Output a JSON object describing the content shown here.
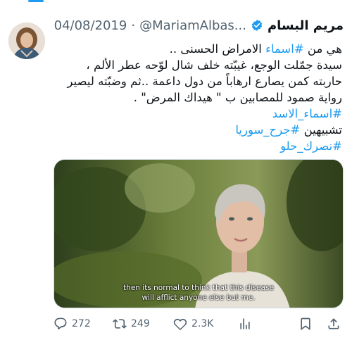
{
  "tweet": {
    "author_name": "مريم البسام",
    "handle": "@MariamAlbas...",
    "separator": "·",
    "date": "04/08/2019",
    "lines": [
      {
        "parts": [
          {
            "t": "هي من "
          },
          {
            "t": "#اسماء",
            "tag": true
          },
          {
            "t": " الامراض الحسنى .."
          }
        ]
      },
      {
        "parts": [
          {
            "t": "سيدة جمّلت الوجع، غيبّته خلف شال لوّحه عطر الألم ،"
          }
        ]
      },
      {
        "parts": [
          {
            "t": "حاربته كمن يصارع ارهاباً من دول داعمة ..ثم وضبّته ليصير"
          }
        ]
      },
      {
        "parts": [
          {
            "t": "رواية صمود للمصابين ب \" هيداك المرض\" ."
          }
        ]
      },
      {
        "parts": [
          {
            "t": "#اسماء_الاسد",
            "tag": true
          }
        ]
      },
      {
        "parts": [
          {
            "t": "تشبيهين "
          },
          {
            "t": "#جرح_سوريا",
            "tag": true
          }
        ]
      },
      {
        "parts": [
          {
            "t": "#نصرك_حلو",
            "tag": true
          }
        ]
      }
    ]
  },
  "media": {
    "subtitle_line1": "then its normal to think that this disease",
    "subtitle_line2": "will afflict anyone else but me."
  },
  "actions": {
    "replies": "272",
    "retweets": "249",
    "likes": "2.3K"
  },
  "colors": {
    "accent": "#1d9bf0",
    "muted": "#536471",
    "text": "#0f1419"
  },
  "icons": [
    "verified-badge-icon",
    "reply-icon",
    "retweet-icon",
    "like-icon",
    "views-icon",
    "bookmark-icon",
    "share-icon"
  ]
}
